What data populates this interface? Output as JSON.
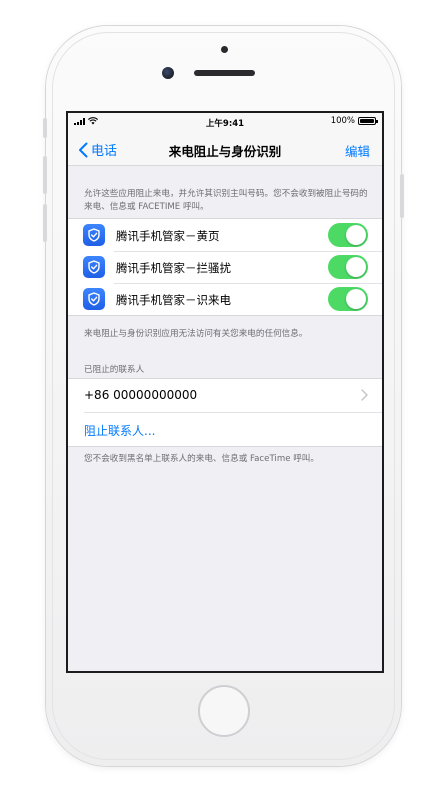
{
  "status_bar": {
    "time": "上午9:41",
    "battery_text": "100%",
    "battery_level": 1.0
  },
  "nav": {
    "back_label": "电话",
    "title": "来电阻止与身份识别",
    "edit_label": "编辑"
  },
  "intro_text": "允许这些应用阻止来电，并允许其识别主叫号码。您不会收到被阻止号码的来电、信息或 FACETIME 呼叫。",
  "apps": [
    {
      "label": "腾讯手机管家－黄页",
      "enabled": true
    },
    {
      "label": "腾讯手机管家－拦骚扰",
      "enabled": true
    },
    {
      "label": "腾讯手机管家－识来电",
      "enabled": true
    }
  ],
  "apps_footer": "来电阻止与身份识别应用无法访问有关您来电的任何信息。",
  "blocked": {
    "header": "已阻止的联系人",
    "contact": "+86 00000000000",
    "block_action": "阻止联系人...",
    "footer": "您不会收到黑名单上联系人的来电、信息或 FaceTime 呼叫。"
  },
  "colors": {
    "accent": "#007aff",
    "toggle_on": "#4cd964",
    "app_icon": "#2f73f5",
    "background": "#efeff4"
  },
  "icons": {
    "back": "chevron-left-icon",
    "app": "shield-check-icon",
    "row_disclosure": "chevron-right-icon"
  }
}
